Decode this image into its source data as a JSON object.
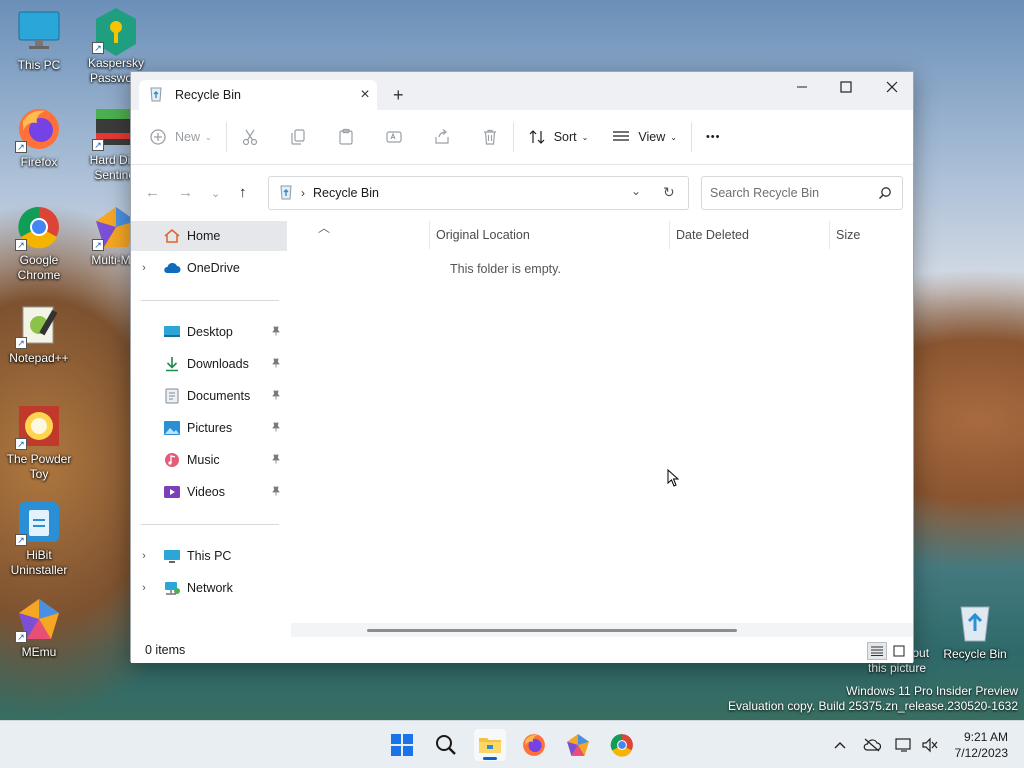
{
  "desktop": {
    "icons": [
      {
        "label": "This PC"
      },
      {
        "label": "Kaspersky Passwo..."
      },
      {
        "label": "Firefox"
      },
      {
        "label": "Hard Disk Sentinel"
      },
      {
        "label": "Google Chrome"
      },
      {
        "label": "Multi-M..."
      },
      {
        "label": "Notepad++"
      },
      {
        "label": "The Powder Toy"
      },
      {
        "label": "HiBit Uninstaller"
      },
      {
        "label": "MEmu"
      },
      {
        "label": "Recycle Bin"
      }
    ],
    "about_picture": "Learn about this picture",
    "watermark_line1": "Windows 11 Pro Insider Preview",
    "watermark_line2": "Evaluation copy. Build 25375.zn_release.230520-1632"
  },
  "window": {
    "tab_title": "Recycle Bin",
    "toolbar": {
      "new_label": "New",
      "sort_label": "Sort",
      "view_label": "View",
      "more_label": "•••"
    },
    "address": {
      "path": "Recycle Bin",
      "search_placeholder": "Search Recycle Bin"
    },
    "nav": {
      "home": "Home",
      "onedrive": "OneDrive",
      "quick": [
        "Desktop",
        "Downloads",
        "Documents",
        "Pictures",
        "Music",
        "Videos"
      ],
      "this_pc": "This PC",
      "network": "Network"
    },
    "columns": [
      "Original Location",
      "Date Deleted",
      "Size"
    ],
    "empty_message": "This folder is empty.",
    "status": "0 items"
  },
  "taskbar": {
    "time": "9:21 AM",
    "date": "7/12/2023"
  },
  "colors": {
    "accent": "#0a64c2",
    "selection": "#e5e7ea",
    "titlebar": "#eef0f3"
  }
}
